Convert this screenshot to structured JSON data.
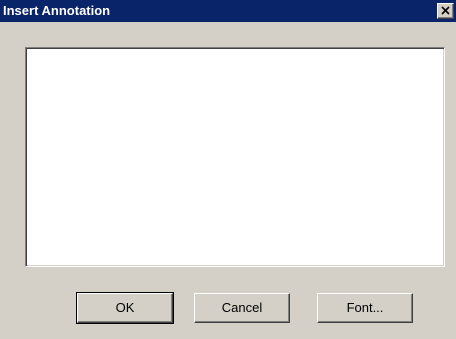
{
  "window": {
    "title": "Insert Annotation",
    "close_glyph": "✕"
  },
  "annotation_field": {
    "value": ""
  },
  "buttons": {
    "ok_label": "OK",
    "cancel_label": "Cancel",
    "font_label": "Font..."
  },
  "colors": {
    "titlebar": "#0a246a",
    "dialog_face": "#d4d0c8",
    "field_background": "#ffffff"
  },
  "icons": {
    "close": "close-icon"
  }
}
